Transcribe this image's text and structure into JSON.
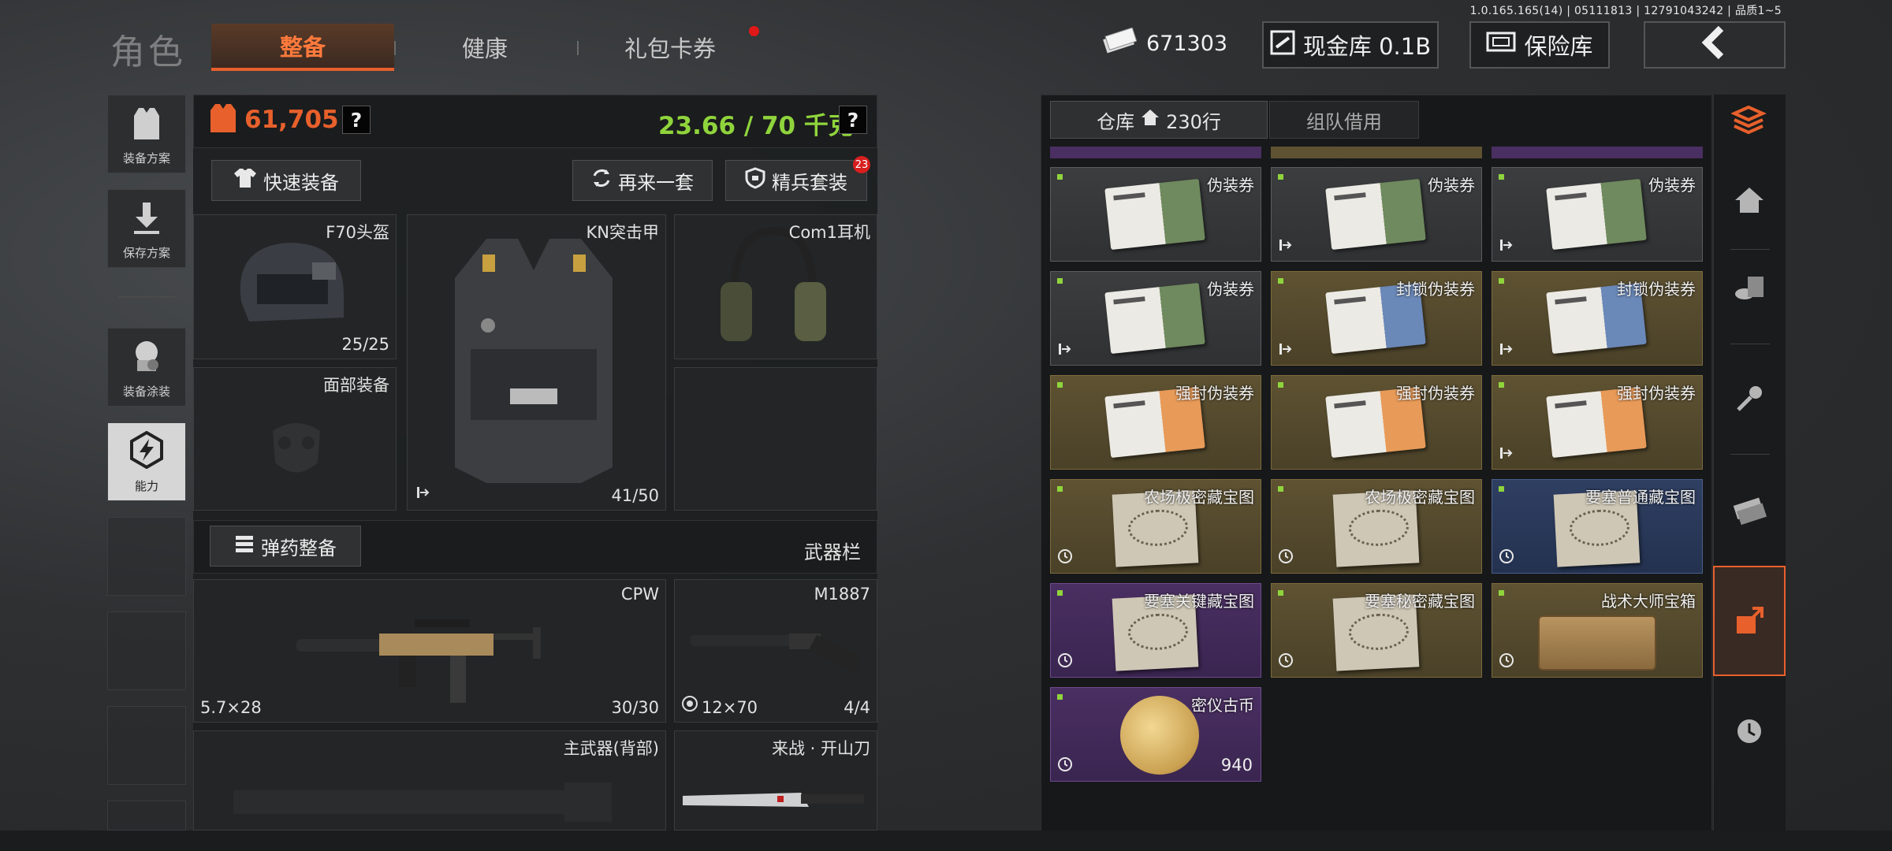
{
  "version": "1.0.165.165(14) | 05111813 | 12791043242 | 品质1~5",
  "nav": {
    "title": "角色",
    "tabs": [
      "整备",
      "健康",
      "礼包卡券"
    ]
  },
  "topbar": {
    "cash": "671303",
    "vault_label": "现金库 0.1B",
    "safe_label": "保险库"
  },
  "sidebar": {
    "items": [
      {
        "label": "装备方案",
        "icon": "vest-icon"
      },
      {
        "label": "保存方案",
        "icon": "download-icon"
      },
      {
        "label": "装备涂装",
        "icon": "camo-icon"
      },
      {
        "label": "能力",
        "icon": "bolt-icon"
      }
    ]
  },
  "loadout": {
    "armor_value": "61,705",
    "weight": "23.66 / 70 千克",
    "quick_equip": "快速装备",
    "again": "再来一套",
    "elite": "精兵套装",
    "elite_badge": "23",
    "slots": {
      "helmet": {
        "name": "F70头盔",
        "durability": "25/25"
      },
      "armor": {
        "name": "KN突击甲",
        "durability": "41/50"
      },
      "headset": {
        "name": "Com1耳机"
      },
      "face": {
        "name": "面部装备"
      }
    },
    "ammo_button": "弹药整备",
    "weapon_bar_label": "武器栏",
    "weapons": {
      "primary": {
        "name": "CPW",
        "ammo": "5.7×28",
        "mag": "30/30"
      },
      "secondary": {
        "name": "M1887",
        "ammo": "12×70",
        "mag": "4/4"
      },
      "back": {
        "name": "主武器(背部)"
      },
      "melee": {
        "name": "来战 · 开山刀"
      }
    }
  },
  "inventory": {
    "tab_storage": "仓库",
    "storage_rows": "230行",
    "tab_team": "组队借用",
    "cells": [
      {
        "name": "伪装券",
        "rarity": "gray",
        "art": "card-green",
        "bl": ""
      },
      {
        "name": "伪装券",
        "rarity": "gray",
        "art": "card-green",
        "bl": "exit"
      },
      {
        "name": "伪装券",
        "rarity": "gray",
        "art": "card-green",
        "bl": "exit"
      },
      {
        "name": "伪装券",
        "rarity": "gray",
        "art": "card-green",
        "bl": "exit"
      },
      {
        "name": "封锁伪装券",
        "rarity": "gold",
        "art": "card-blue",
        "bl": "exit"
      },
      {
        "name": "封锁伪装券",
        "rarity": "gold",
        "art": "card-blue",
        "bl": "exit"
      },
      {
        "name": "强封伪装券",
        "rarity": "gold",
        "art": "card-orange",
        "bl": ""
      },
      {
        "name": "强封伪装券",
        "rarity": "gold",
        "art": "card-orange",
        "bl": ""
      },
      {
        "name": "强封伪装券",
        "rarity": "gold",
        "art": "card-orange",
        "bl": "exit"
      },
      {
        "name": "农场极密藏宝图",
        "rarity": "gold",
        "art": "map",
        "bl": "clock"
      },
      {
        "name": "农场极密藏宝图",
        "rarity": "gold",
        "art": "map",
        "bl": "clock"
      },
      {
        "name": "要塞普通藏宝图",
        "rarity": "blue",
        "art": "map",
        "bl": "clock"
      },
      {
        "name": "要塞关键藏宝图",
        "rarity": "purple",
        "art": "map",
        "bl": "clock"
      },
      {
        "name": "要塞秘密藏宝图",
        "rarity": "gold",
        "art": "map",
        "bl": "clock"
      },
      {
        "name": "战术大师宝箱",
        "rarity": "gold",
        "art": "chest",
        "bl": "clock"
      },
      {
        "name": "密仪古币",
        "rarity": "purple",
        "art": "coin",
        "bl": "clock",
        "count": "940"
      }
    ]
  },
  "rail": {
    "icons": [
      "sort-icon",
      "home-icon",
      "coins-icon",
      "key-icon",
      "cash-icon",
      "storage-out-icon",
      "clock-icon"
    ]
  }
}
